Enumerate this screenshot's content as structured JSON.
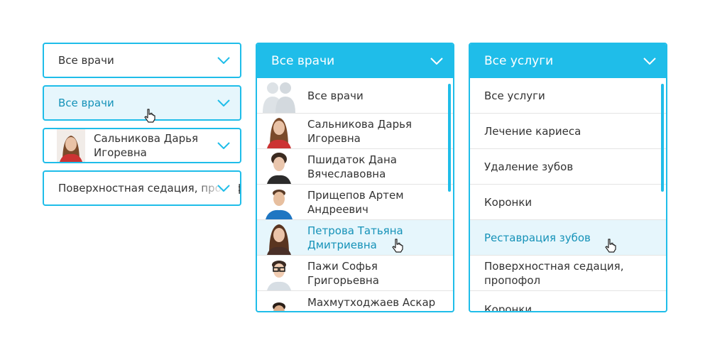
{
  "selects": {
    "default": {
      "value": "Все врачи"
    },
    "hover": {
      "value": "Все врачи"
    },
    "doctor": {
      "line1": "Сальникова Дарья",
      "line2": "Игоревна"
    },
    "service": {
      "value": "Поверхностная седация, пропофол"
    }
  },
  "doctors_dropdown": {
    "header": "Все врачи",
    "items": [
      {
        "lines": [
          "Все врачи"
        ],
        "avatar": "group-silhouette-icon"
      },
      {
        "lines": [
          "Сальникова Дарья",
          "Игоревна"
        ],
        "avatar": "doctor-photo"
      },
      {
        "lines": [
          "Пшидаток Дана",
          "Вячеславовна"
        ],
        "avatar": "doctor-photo"
      },
      {
        "lines": [
          "Прищепов Артем",
          "Андреевич"
        ],
        "avatar": "doctor-photo"
      },
      {
        "lines": [
          "Петрова Татьяна",
          "Дмитриевна"
        ],
        "avatar": "doctor-photo",
        "highlighted": true
      },
      {
        "lines": [
          "Пажи Софья",
          "Григорьевна"
        ],
        "avatar": "doctor-photo"
      },
      {
        "lines": [
          "Махмутходжаев Аскар",
          ""
        ],
        "avatar": "doctor-photo"
      }
    ]
  },
  "services_dropdown": {
    "header": "Все услуги",
    "items": [
      {
        "lines": [
          "Все услуги"
        ]
      },
      {
        "lines": [
          "Лечение кариеса"
        ]
      },
      {
        "lines": [
          "Удаление зубов"
        ]
      },
      {
        "lines": [
          "Коронки"
        ]
      },
      {
        "lines": [
          "Реставрация зубов"
        ],
        "highlighted": true
      },
      {
        "lines": [
          "Поверхностная седация,",
          "пропофол"
        ]
      },
      {
        "lines": [
          "Коронки"
        ]
      }
    ]
  },
  "colors": {
    "accent": "#1fbde9",
    "hover_bg": "#e6f6fc",
    "hover_text": "#1592b8",
    "text": "#333333"
  },
  "icons": {
    "chevron": "chevron-down-icon",
    "cursor": "hand-pointer-icon",
    "placeholder_avatar": "group-silhouette-icon"
  }
}
